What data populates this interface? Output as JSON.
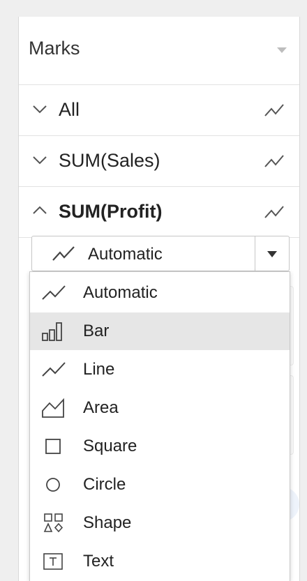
{
  "marks_panel": {
    "title": "Marks",
    "rows": [
      {
        "label": "All",
        "expanded": false,
        "icon": "line-mark-icon"
      },
      {
        "label": "SUM(Sales)",
        "expanded": false,
        "icon": "line-mark-icon"
      },
      {
        "label": "SUM(Profit)",
        "expanded": true,
        "icon": "line-mark-icon"
      }
    ]
  },
  "mark_type_select": {
    "selected": "Automatic",
    "icon": "automatic-line-icon"
  },
  "mark_type_menu": {
    "hovered": "Bar",
    "items": [
      {
        "label": "Automatic",
        "icon": "automatic-line-icon"
      },
      {
        "label": "Bar",
        "icon": "bar-icon"
      },
      {
        "label": "Line",
        "icon": "line-icon"
      },
      {
        "label": "Area",
        "icon": "area-icon"
      },
      {
        "label": "Square",
        "icon": "square-icon"
      },
      {
        "label": "Circle",
        "icon": "circle-icon"
      },
      {
        "label": "Shape",
        "icon": "shape-icon"
      },
      {
        "label": "Text",
        "icon": "text-icon"
      }
    ]
  },
  "colors": {
    "hover_bg": "#e6e6e6",
    "border": "#c6c6c6",
    "text": "#222222"
  }
}
